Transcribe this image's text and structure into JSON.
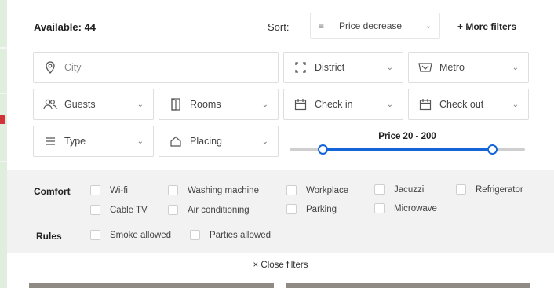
{
  "topbar": {
    "available_label": "Available:",
    "available_count": "44",
    "sort_label": "Sort:",
    "sort_value": "Price decrease",
    "more_filters": "+ More filters"
  },
  "fields": {
    "city": "City",
    "district": "District",
    "metro": "Metro",
    "guests": "Guests",
    "rooms": "Rooms",
    "check_in": "Check in",
    "check_out": "Check out",
    "type": "Type",
    "placing": "Placing"
  },
  "price": {
    "label": "Price 20 - 200",
    "min_fraction": 0.14,
    "max_fraction": 0.86
  },
  "comfort": {
    "label": "Comfort",
    "options": [
      "Wi-fi",
      "Washing machine",
      "Workplace",
      "Jacuzzi",
      "Refrigerator",
      "Cable TV",
      "Air conditioning",
      "Parking",
      "Microwave"
    ]
  },
  "rules": {
    "label": "Rules",
    "options": [
      "Smoke allowed",
      "Parties allowed"
    ]
  },
  "close_filters": "× Close filters",
  "colors": {
    "accent": "#1565d8",
    "filter_bg": "#f2f2f2",
    "border": "#dedede"
  },
  "icons": {
    "sort": "list-lines-icon",
    "city": "map-pin-icon",
    "district": "bracket-frame-icon",
    "metro": "metro-icon",
    "guests": "people-icon",
    "rooms": "door-icon",
    "check_in": "calendar-icon",
    "check_out": "calendar-icon",
    "type": "list-lines-icon",
    "placing": "house-icon",
    "chevron": "chevron-down-icon"
  }
}
